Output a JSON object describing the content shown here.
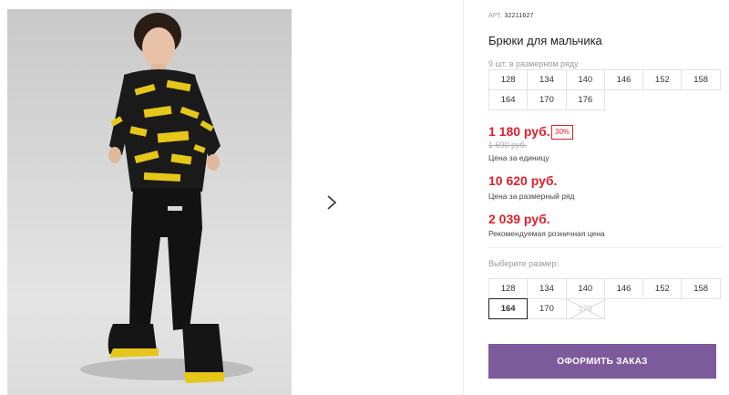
{
  "product": {
    "article_label": "АРТ.",
    "article_number": "32211627",
    "title": "Брюки для мальчика"
  },
  "size_range": {
    "caption": "9 шт. в размерном ряду",
    "sizes": [
      "128",
      "134",
      "140",
      "146",
      "152",
      "158",
      "164",
      "170",
      "176"
    ]
  },
  "pricing": {
    "unit_price": "1 180 руб.",
    "discount": "30%",
    "old_price": "1 690 руб.",
    "unit_label": "Цена за единицу",
    "range_price": "10 620 руб.",
    "range_label": "Цена за размерный ряд",
    "recommended_price": "2 039 руб.",
    "recommended_label": "Рекомендуемая розничная цена"
  },
  "size_picker": {
    "caption": "Выберите размер:",
    "sizes": [
      "128",
      "134",
      "140",
      "146",
      "152",
      "158",
      "164",
      "170",
      "176"
    ],
    "selected": "164",
    "unavailable": [
      "176"
    ]
  },
  "actions": {
    "order_label": "ОФОРМИТЬ ЗАКАЗ"
  },
  "colors": {
    "price": "#e0202c",
    "button": "#7d5a9c"
  },
  "icons": {
    "next": "chevron-right-icon"
  }
}
